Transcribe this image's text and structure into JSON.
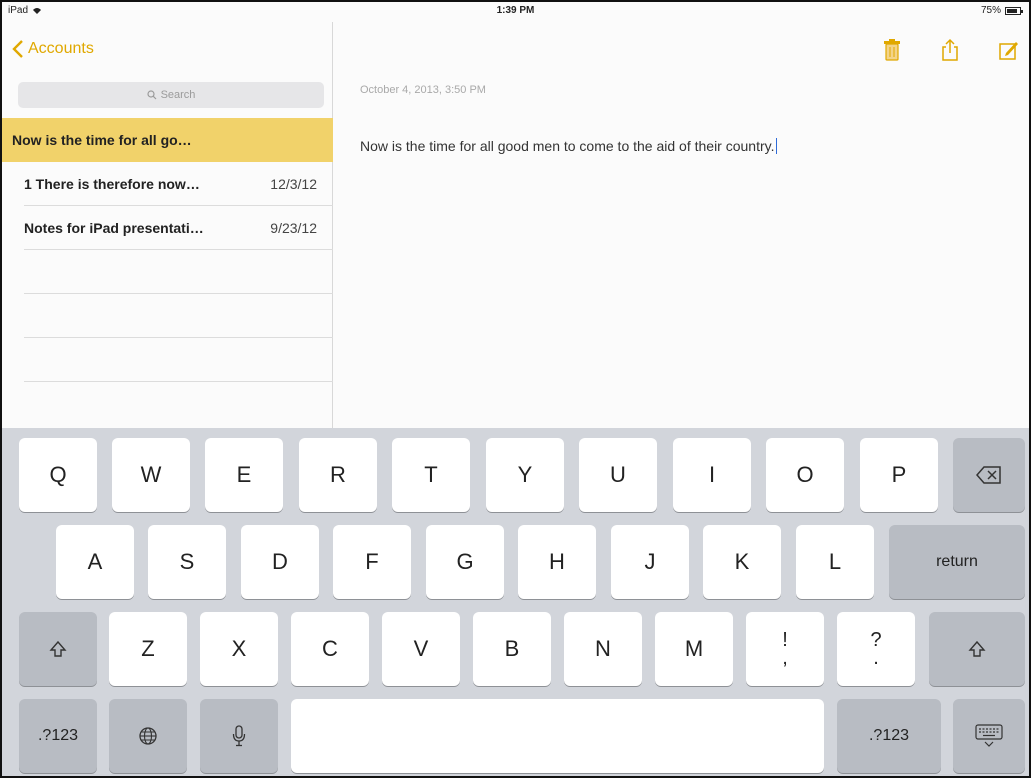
{
  "status_bar": {
    "device": "iPad",
    "time": "1:39 PM",
    "battery": "75%"
  },
  "sidebar": {
    "back_label": "Accounts",
    "search_placeholder": "Search",
    "notes": [
      {
        "title": "Now is the time for all go…",
        "date": ""
      },
      {
        "title": "1 There is therefore now…",
        "date": "12/3/12"
      },
      {
        "title": "Notes for iPad presentati…",
        "date": "9/23/12"
      }
    ]
  },
  "note": {
    "date": "October 4, 2013, 3:50 PM",
    "body": "Now is the time for all good men to come to the aid of their country."
  },
  "toolbar": {
    "icons": [
      "trash-icon",
      "share-icon",
      "compose-icon"
    ]
  },
  "colors": {
    "accent": "#e0a800",
    "selected_row": "#f1d26a",
    "keyboard_bg": "#d2d5db"
  },
  "keyboard": {
    "row1": [
      "Q",
      "W",
      "E",
      "R",
      "T",
      "Y",
      "U",
      "I",
      "O",
      "P"
    ],
    "row2": [
      "A",
      "S",
      "D",
      "F",
      "G",
      "H",
      "J",
      "K",
      "L"
    ],
    "row3": [
      "Z",
      "X",
      "C",
      "V",
      "B",
      "N",
      "M"
    ],
    "exclaim_top": "!",
    "exclaim_bottom": ",",
    "question_top": "?",
    "question_bottom": ".",
    "return_label": "return",
    "numbers_label": ".?123"
  }
}
